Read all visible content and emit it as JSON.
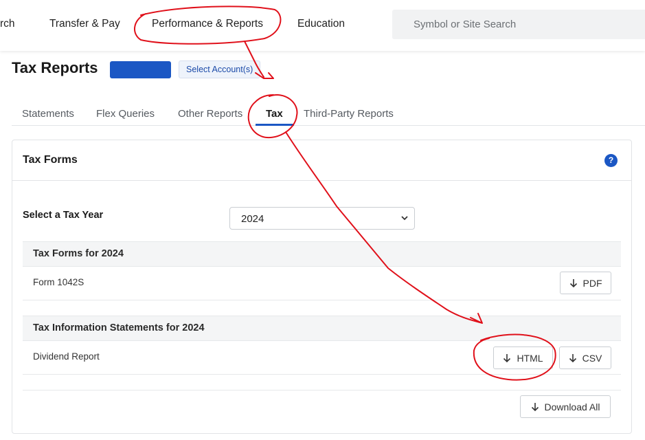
{
  "nav": {
    "items": [
      "rch",
      "Transfer & Pay",
      "Performance & Reports",
      "Education"
    ],
    "search_placeholder": "Symbol or Site Search"
  },
  "header": {
    "title": "Tax Reports",
    "account_name": "",
    "select_account": "Select Account(s)"
  },
  "tabs": [
    {
      "label": "Statements",
      "active": false
    },
    {
      "label": "Flex Queries",
      "active": false
    },
    {
      "label": "Other Reports",
      "active": false
    },
    {
      "label": "Tax",
      "active": true
    },
    {
      "label": "Third-Party Reports",
      "active": false
    }
  ],
  "card": {
    "title": "Tax Forms",
    "help": "?",
    "year_label": "Select a Tax Year",
    "year_value": "2024",
    "sections": [
      {
        "title": "Tax Forms for 2024",
        "rows": [
          {
            "label": "Form 1042S",
            "buttons": [
              "PDF"
            ]
          }
        ]
      },
      {
        "title": "Tax Information Statements for 2024",
        "rows": [
          {
            "label": "Dividend Report",
            "buttons": [
              "HTML",
              "CSV"
            ]
          }
        ]
      }
    ],
    "download_all": "Download All"
  },
  "colors": {
    "accent": "#1b57c4",
    "annotation": "#e0101a"
  }
}
